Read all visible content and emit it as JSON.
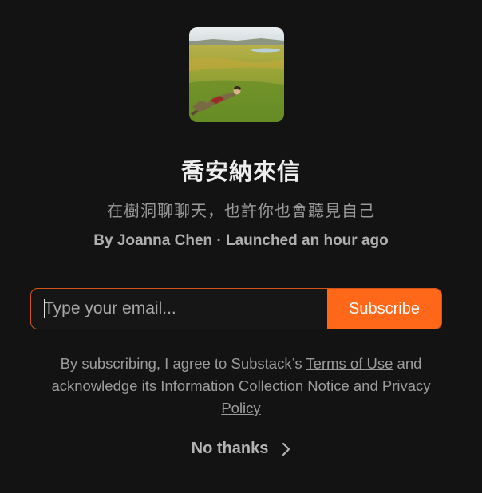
{
  "publication": {
    "title": "喬安納來信",
    "subtitle": "在樹洞聊聊天，也許你也會聽見自己",
    "byline": "By Joanna Chen · Launched an hour ago",
    "cover_icon": "cover-photo-field"
  },
  "form": {
    "email_placeholder": "Type your email...",
    "email_value": "",
    "subscribe_label": "Subscribe",
    "accent_color": "#ff6719"
  },
  "legal": {
    "text_1": "By subscribing, I agree to Substack’s ",
    "terms_link": "Terms of Use",
    "text_2": " and acknowledge its ",
    "info_link": "Information Collection Notice",
    "text_3": " and ",
    "privacy_link": "Privacy Policy"
  },
  "skip": {
    "label": "No thanks",
    "icon": "chevron-right-icon"
  }
}
